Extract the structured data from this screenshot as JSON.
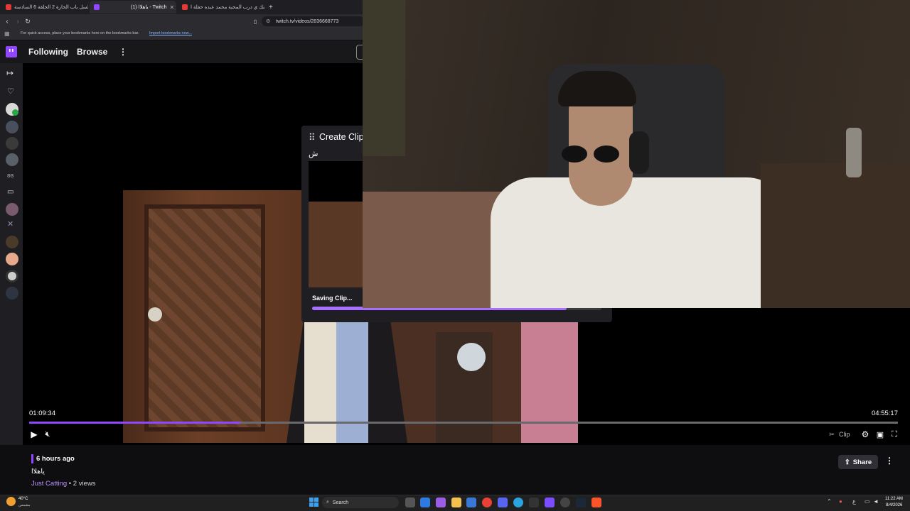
{
  "browser": {
    "tabs": [
      {
        "title": "مسلسل باب الحارة 2 الحلقة 6 السادسة",
        "favicon_color": "#e53935"
      },
      {
        "title": "(1) ياهلاا - Twitch",
        "favicon_color": "#9147ff"
      },
      {
        "title": "وينك ي درب المحبة محمد عبده حفلة ا...",
        "favicon_color": "#e53935"
      }
    ],
    "new_tab": "+",
    "url": "twitch.tv/videos/2836668773",
    "bookmarks_text": "For quick access, place your bookmarks here on the bookmarks bar.",
    "bookmarks_link": "Import bookmarks now..."
  },
  "topnav": {
    "following": "Following",
    "browse": "Browse",
    "more": "⋮"
  },
  "clip_panel": {
    "title": "Create Clip",
    "clip_title": "ش",
    "status": "Saving Clip...",
    "progress": 0.88
  },
  "player": {
    "current_time": "01:09:34",
    "duration": "04:55:17",
    "progress": 0.243,
    "clip_label": "Clip"
  },
  "video_info": {
    "age": "6 hours ago",
    "title": "ياهلاا",
    "category": "Just Catting",
    "views": " • 2 views",
    "share_label": "Share"
  },
  "taskbar": {
    "weather_temp": "40°C",
    "weather_desc": "مشمس",
    "search_placeholder": "Search",
    "time": "11:22 AM",
    "date": "8/4/2026",
    "lang": "ع"
  },
  "colors": {
    "twitch_purple": "#9147ff",
    "clip_progress": "#a970ff",
    "bg": "#0e0e10"
  }
}
